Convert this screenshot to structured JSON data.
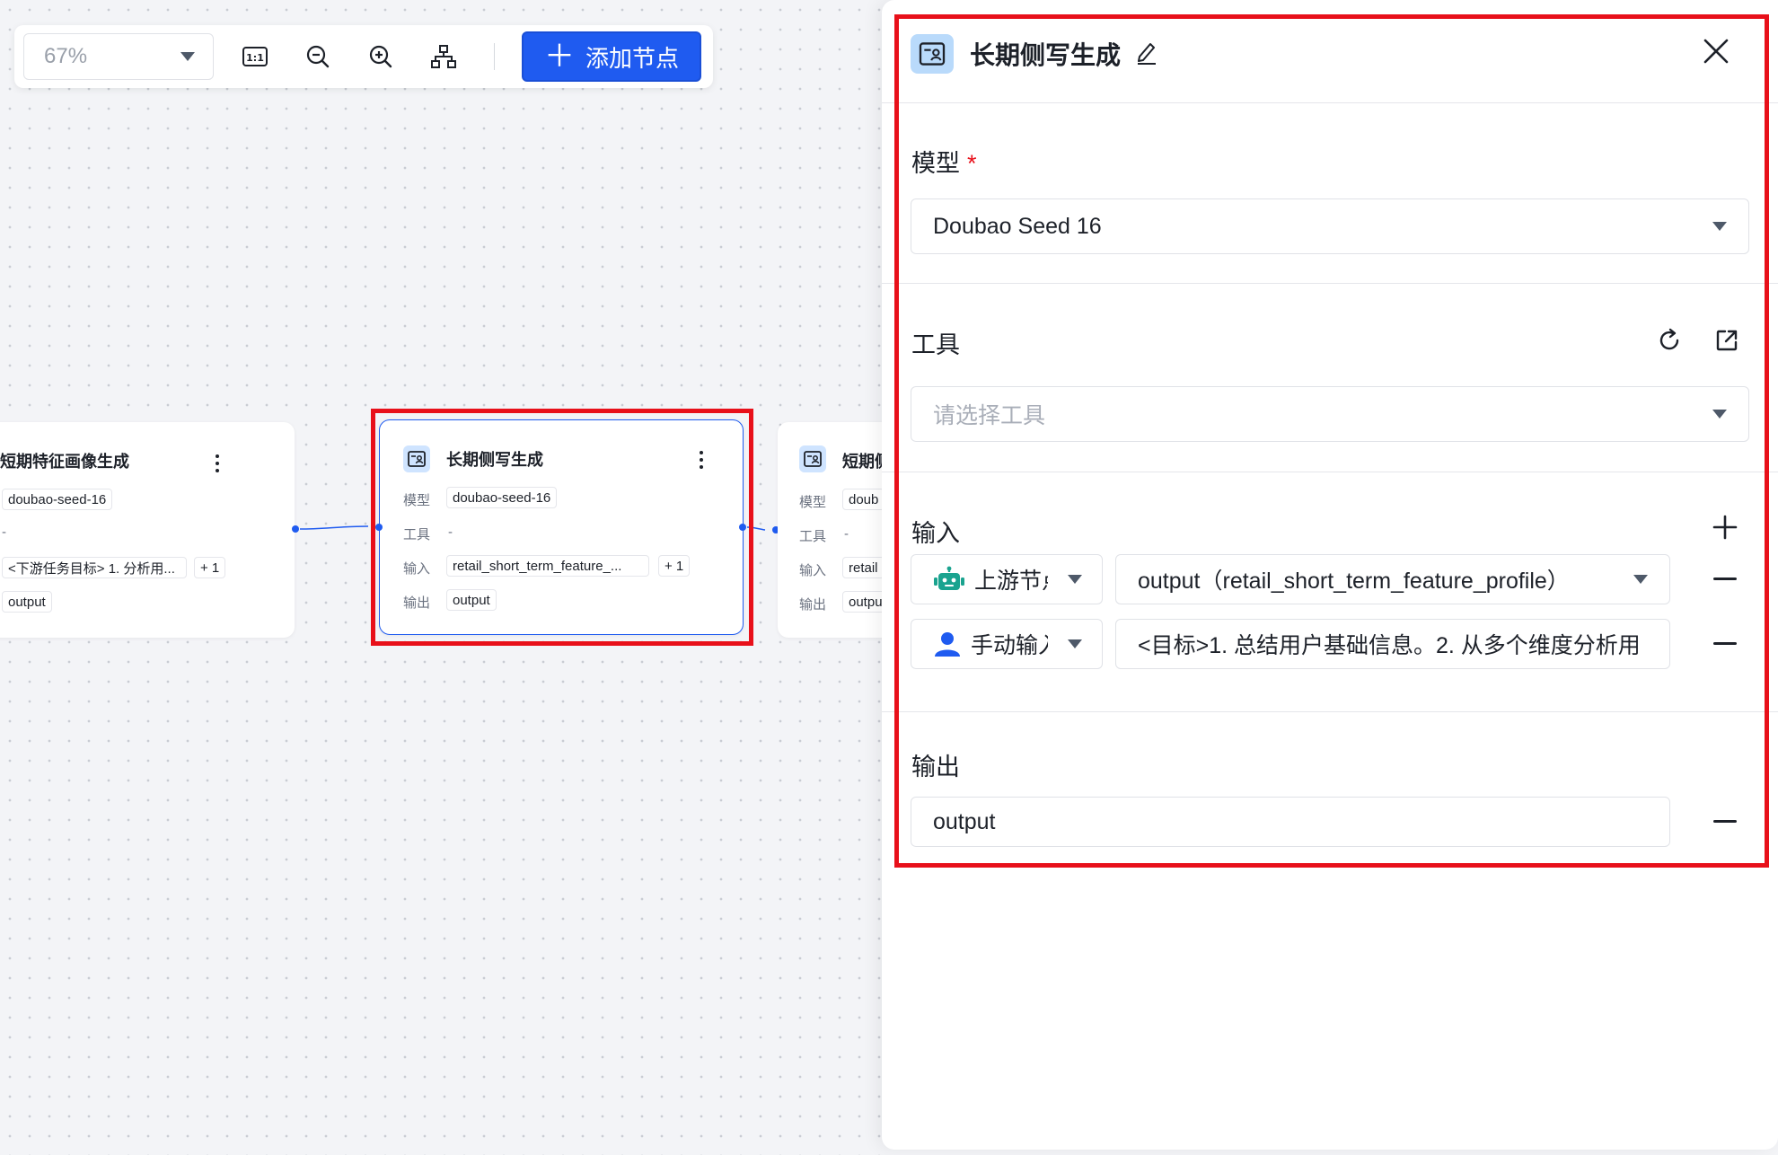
{
  "toolbar": {
    "zoom_value": "67%",
    "fit_label": "1:1",
    "add_node_label": "添加节点"
  },
  "nodes": {
    "left": {
      "title": "短期特征画像生成",
      "model": "doubao-seed-16",
      "tool": "-",
      "input": "<下游任务目标> 1. 分析用...",
      "input_extra": "+ 1",
      "output": "output"
    },
    "center": {
      "title": "长期侧写生成",
      "model_label": "模型",
      "tool_label": "工具",
      "input_label": "输入",
      "output_label": "输出",
      "model": "doubao-seed-16",
      "tool": "-",
      "input": "retail_short_term_feature_...",
      "input_extra": "+ 1",
      "output": "output"
    },
    "right": {
      "title": "短期侧",
      "model_label": "模型",
      "tool_label": "工具",
      "input_label": "输入",
      "output_label": "输出",
      "model": "doub",
      "tool": "-",
      "input": "retail",
      "output": "outpu"
    }
  },
  "panel": {
    "title": "长期侧写生成",
    "model": {
      "label": "模型",
      "required_mark": "*",
      "value": "Doubao Seed 16"
    },
    "tools": {
      "label": "工具",
      "placeholder": "请选择工具"
    },
    "inputs": {
      "label": "输入",
      "rows": [
        {
          "source": "上游节点",
          "value": "output（retail_short_term_feature_profile）"
        },
        {
          "source": "手动输入",
          "value": "<目标>1. 总结用户基础信息。2. 从多个维度分析用"
        }
      ]
    },
    "output": {
      "label": "输出",
      "value": "output"
    }
  },
  "colors": {
    "primary": "#1f5bf0",
    "highlight": "#e8101a",
    "bot_icon": "#1aa38f"
  }
}
